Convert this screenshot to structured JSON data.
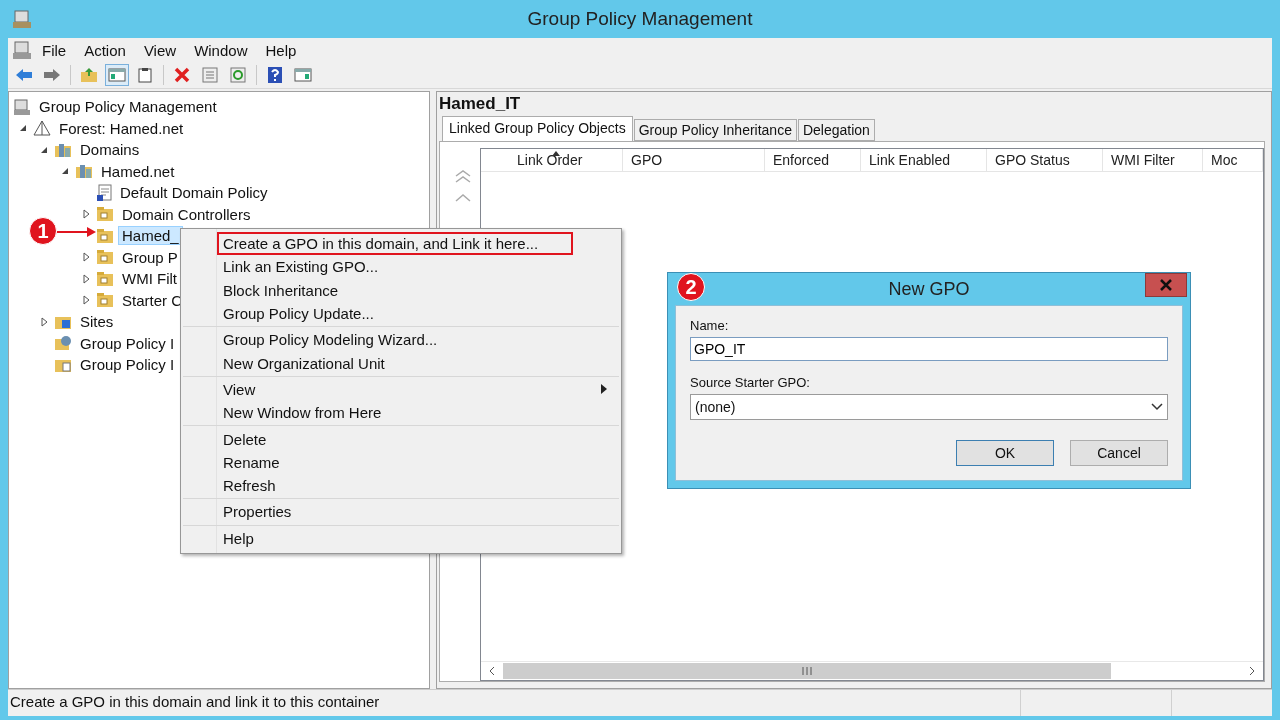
{
  "window": {
    "title": "Group Policy Management"
  },
  "menu_bar": [
    {
      "label": "File"
    },
    {
      "label": "Action"
    },
    {
      "label": "View"
    },
    {
      "label": "Window"
    },
    {
      "label": "Help"
    }
  ],
  "toolbar": [
    {
      "kind": "back"
    },
    {
      "kind": "forward"
    },
    {
      "kind": "sep"
    },
    {
      "kind": "up"
    },
    {
      "kind": "pane",
      "selected": true
    },
    {
      "kind": "clipboard"
    },
    {
      "kind": "sep"
    },
    {
      "kind": "delete"
    },
    {
      "kind": "properties"
    },
    {
      "kind": "refresh"
    },
    {
      "kind": "sep"
    },
    {
      "kind": "help"
    },
    {
      "kind": "panel"
    }
  ],
  "tree": [
    {
      "label": "Group Policy Management",
      "kind": "console",
      "selected": false,
      "children": [
        {
          "label": "Forest: Hamed.net",
          "kind": "forest",
          "expanded": true,
          "selected": false,
          "children": [
            {
              "label": "Domains",
              "kind": "domains",
              "expanded": true,
              "selected": false,
              "children": [
                {
                  "label": "Hamed.net",
                  "kind": "domain",
                  "expanded": true,
                  "selected": false,
                  "children": [
                    {
                      "label": "Default Domain Policy",
                      "kind": "gpo",
                      "selected": false
                    },
                    {
                      "label": "Domain Controllers",
                      "kind": "folder",
                      "expanded": false,
                      "selected": false
                    },
                    {
                      "label": "Hamed_",
                      "kind": "folder",
                      "selected": true
                    },
                    {
                      "label": "Group P",
                      "kind": "folder",
                      "expanded": false,
                      "selected": false
                    },
                    {
                      "label": "WMI Filt",
                      "kind": "folder",
                      "expanded": false,
                      "selected": false
                    },
                    {
                      "label": "Starter C",
                      "kind": "folder",
                      "expanded": false,
                      "selected": false
                    }
                  ]
                }
              ]
            },
            {
              "label": "Sites",
              "kind": "sites",
              "expanded": false,
              "selected": false
            },
            {
              "label": "Group Policy I",
              "kind": "modeling",
              "selected": false
            },
            {
              "label": "Group Policy I",
              "kind": "results",
              "selected": false
            }
          ]
        }
      ]
    }
  ],
  "details": {
    "title": "Hamed_IT",
    "tabs": [
      {
        "label": "Linked Group Policy Objects",
        "selected": true
      },
      {
        "label": "Group Policy Inheritance",
        "selected": false
      },
      {
        "label": "Delegation",
        "selected": false
      }
    ],
    "columns": [
      {
        "label": "Link Order",
        "sorted": true
      },
      {
        "label": "GPO",
        "sorted": false
      },
      {
        "label": "Enforced",
        "sorted": false
      },
      {
        "label": "Link Enabled",
        "sorted": false
      },
      {
        "label": "GPO Status",
        "sorted": false
      },
      {
        "label": "WMI Filter",
        "sorted": false
      },
      {
        "label": "Moc",
        "sorted": false
      }
    ]
  },
  "context_menu": {
    "groups": [
      {
        "items": [
          {
            "label": "Create a GPO in this domain, and Link it here...",
            "annotated": true
          },
          {
            "label": "Link an Existing GPO...",
            "annotated": false
          },
          {
            "label": "Block Inheritance",
            "annotated": false
          },
          {
            "label": "Group Policy Update...",
            "annotated": false
          }
        ]
      },
      {
        "items": [
          {
            "label": "Group Policy Modeling Wizard...",
            "annotated": false
          },
          {
            "label": "New Organizational Unit",
            "annotated": false
          }
        ]
      },
      {
        "items": [
          {
            "label": "View",
            "submenu": true,
            "annotated": false
          },
          {
            "label": "New Window from Here",
            "annotated": false
          }
        ]
      },
      {
        "items": [
          {
            "label": "Delete",
            "annotated": false
          },
          {
            "label": "Rename",
            "annotated": false
          },
          {
            "label": "Refresh",
            "annotated": false
          }
        ]
      },
      {
        "items": [
          {
            "label": "Properties",
            "annotated": false
          }
        ]
      },
      {
        "items": [
          {
            "label": "Help",
            "annotated": false
          }
        ]
      }
    ]
  },
  "dialog": {
    "title": "New GPO",
    "name_label": "Name:",
    "name_value": "GPO_IT",
    "source_label": "Source Starter GPO:",
    "source_value": "(none)",
    "buttons": [
      {
        "label": "OK",
        "default": true
      },
      {
        "label": "Cancel",
        "default": false
      }
    ]
  },
  "annotations": [
    {
      "label": "1"
    },
    {
      "label": "2"
    }
  ],
  "status_bar": {
    "text": "Create a GPO in this domain and link it to this container"
  }
}
